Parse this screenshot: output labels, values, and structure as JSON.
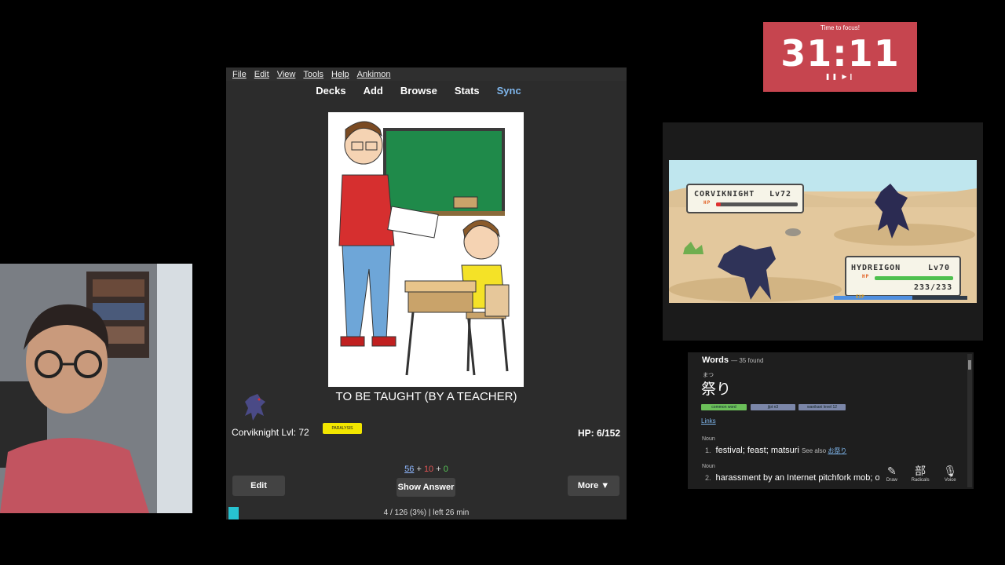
{
  "timer": {
    "title": "Time to focus!",
    "time": "31:11",
    "controls": "❚❚ ▶❙"
  },
  "anki": {
    "menu": [
      "File",
      "Edit",
      "View",
      "Tools",
      "Help",
      "Ankimon"
    ],
    "toolbar": {
      "decks": "Decks",
      "add": "Add",
      "browse": "Browse",
      "stats": "Stats",
      "sync": "Sync"
    },
    "card_text": "TO BE TAUGHT (BY A TEACHER)",
    "pokemon_label": "Corviknight Lvl: 72",
    "status_badge": "PARALYSIS",
    "hp": "HP: 6/152",
    "counts": {
      "new": "56",
      "learn": "10",
      "review": "0",
      "plus": "+"
    },
    "buttons": {
      "edit": "Edit",
      "show_answer": "Show Answer",
      "more": "More ▼"
    },
    "progress": "4 / 126 (3%) | left 26 min"
  },
  "game": {
    "enemy": {
      "name": "CORVIKNIGHT",
      "level": "Lv72",
      "hp_tag": "HP"
    },
    "player": {
      "name": "HYDREIGON",
      "level": "Lv70",
      "hp_tag": "HP",
      "hp_text": "233/233",
      "exp_tag": "EXP"
    }
  },
  "words": {
    "title": "Words",
    "found": "— 35 found",
    "furigana": "まつ",
    "word": "祭り",
    "tags": [
      "common word",
      "jlpt n3",
      "wanikani level 12"
    ],
    "links": "Links",
    "senses": [
      {
        "pos": "Noun",
        "num": "1.",
        "text": "festival; feast; matsuri",
        "see_prefix": "See also",
        "see_link": "お祭り"
      },
      {
        "pos": "Noun",
        "num": "2.",
        "text": "harassment by an Internet pitchfork mob; on"
      }
    ],
    "tools": [
      {
        "icon": "✎",
        "label": "Draw"
      },
      {
        "icon": "部",
        "label": "Radicals"
      },
      {
        "icon": "🎙",
        "label": "Voice"
      }
    ]
  },
  "colors": {
    "timer_bg": "#c6454f",
    "sync": "#7fb6ec",
    "badge": "#f2e600",
    "new": "#8fb8ff",
    "learn": "#e05555",
    "review": "#57c457",
    "progress": "#27c3d1"
  }
}
